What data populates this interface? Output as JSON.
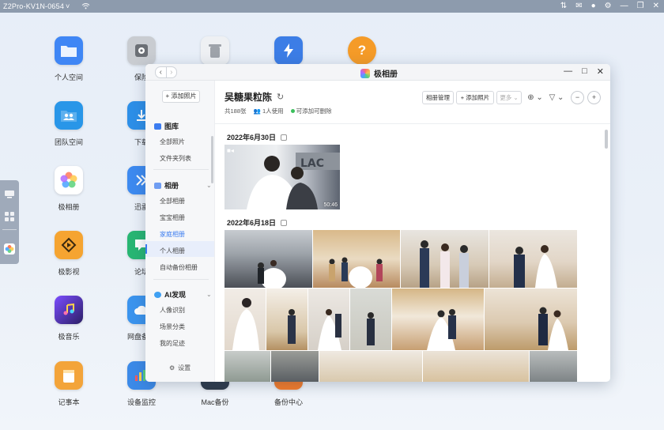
{
  "system_bar": {
    "device_name": "Z2Pro-KV1N-0654",
    "dropdown_glyph": "˅",
    "icons": [
      "wifi-icon",
      "transfer-icon",
      "mail-icon",
      "user-icon",
      "settings-icon",
      "minimize-icon",
      "restore-icon",
      "close-icon"
    ]
  },
  "desktop": {
    "icons": [
      {
        "label": "个人空间",
        "icon": "folder-icon",
        "color": "#3f86f5"
      },
      {
        "label": "保险",
        "icon": "safe-icon",
        "color": "#8c8f94"
      },
      {
        "label": "",
        "icon": "trash-icon",
        "color": "#e9ecef"
      },
      {
        "label": "",
        "icon": "lightning-icon",
        "color": "#3c7de6"
      },
      {
        "label": "",
        "icon": "help-icon",
        "color": "#f59b28"
      },
      {
        "label": "团队空间",
        "icon": "team-folder-icon",
        "color": "#2996e8"
      },
      {
        "label": "下载",
        "icon": "download-icon",
        "color": "#2d8fe8"
      },
      {
        "label": "极相册",
        "icon": "photos-icon",
        "color": "#ffffff"
      },
      {
        "label": "迅雷",
        "icon": "thunder-icon",
        "color": "#3d8af0"
      },
      {
        "label": "极影视",
        "icon": "video-icon",
        "color": "#f5a431"
      },
      {
        "label": "论坛",
        "icon": "forum-icon",
        "color": "#28b673"
      },
      {
        "label": "极音乐",
        "icon": "music-icon",
        "color": "#5a3fd6"
      },
      {
        "label": "网盘备份",
        "icon": "cloud-backup-icon",
        "color": "#3b94ee"
      },
      {
        "label": "记事本",
        "icon": "notepad-icon",
        "color": "#f3a43a"
      },
      {
        "label": "设备监控",
        "icon": "monitor-icon",
        "color": "#3c8ae8"
      },
      {
        "label": "Mac备份",
        "icon": "mac-backup-icon",
        "color": "#2f3b4a"
      },
      {
        "label": "备份中心",
        "icon": "backup-center-icon",
        "color": "#f57c2a"
      }
    ]
  },
  "dock": {
    "items": [
      "display-icon",
      "apps-grid-icon",
      "photos-app-icon"
    ]
  },
  "window": {
    "title": "极相册",
    "nav_back": "‹",
    "nav_forward": "›",
    "controls": {
      "minimize": "—",
      "maximize": "□",
      "close": "✕"
    }
  },
  "sidebar": {
    "add_photo": "+ 添加照片",
    "library": {
      "title": "图库",
      "items": [
        "全部照片",
        "文件夹列表"
      ]
    },
    "albums": {
      "title": "相册",
      "items": [
        "全部相册",
        "宝宝相册",
        "家庭相册",
        "个人相册",
        "自动备份相册"
      ],
      "active": "家庭相册"
    },
    "ai": {
      "title": "AI发现",
      "items": [
        "人像识别",
        "场景分类",
        "我的足迹"
      ]
    },
    "settings": "设置"
  },
  "main": {
    "album_title": "吴糖果粒陈",
    "refresh_glyph": "↻",
    "photo_count": "共188张",
    "users": "1人使用",
    "permission": "可添加可删除",
    "toolbar": {
      "manage": "相册管理",
      "add_photo": "+ 添加照片",
      "more": "更多 ⌄",
      "sort_glyph": "⊕ ⌄",
      "filter_glyph": "▽ ⌄",
      "zoom_out": "−",
      "zoom_in": "+"
    },
    "groups": [
      {
        "date": "2022年6月30日",
        "video_duration": "50:46"
      },
      {
        "date": "2022年6月18日"
      }
    ]
  }
}
